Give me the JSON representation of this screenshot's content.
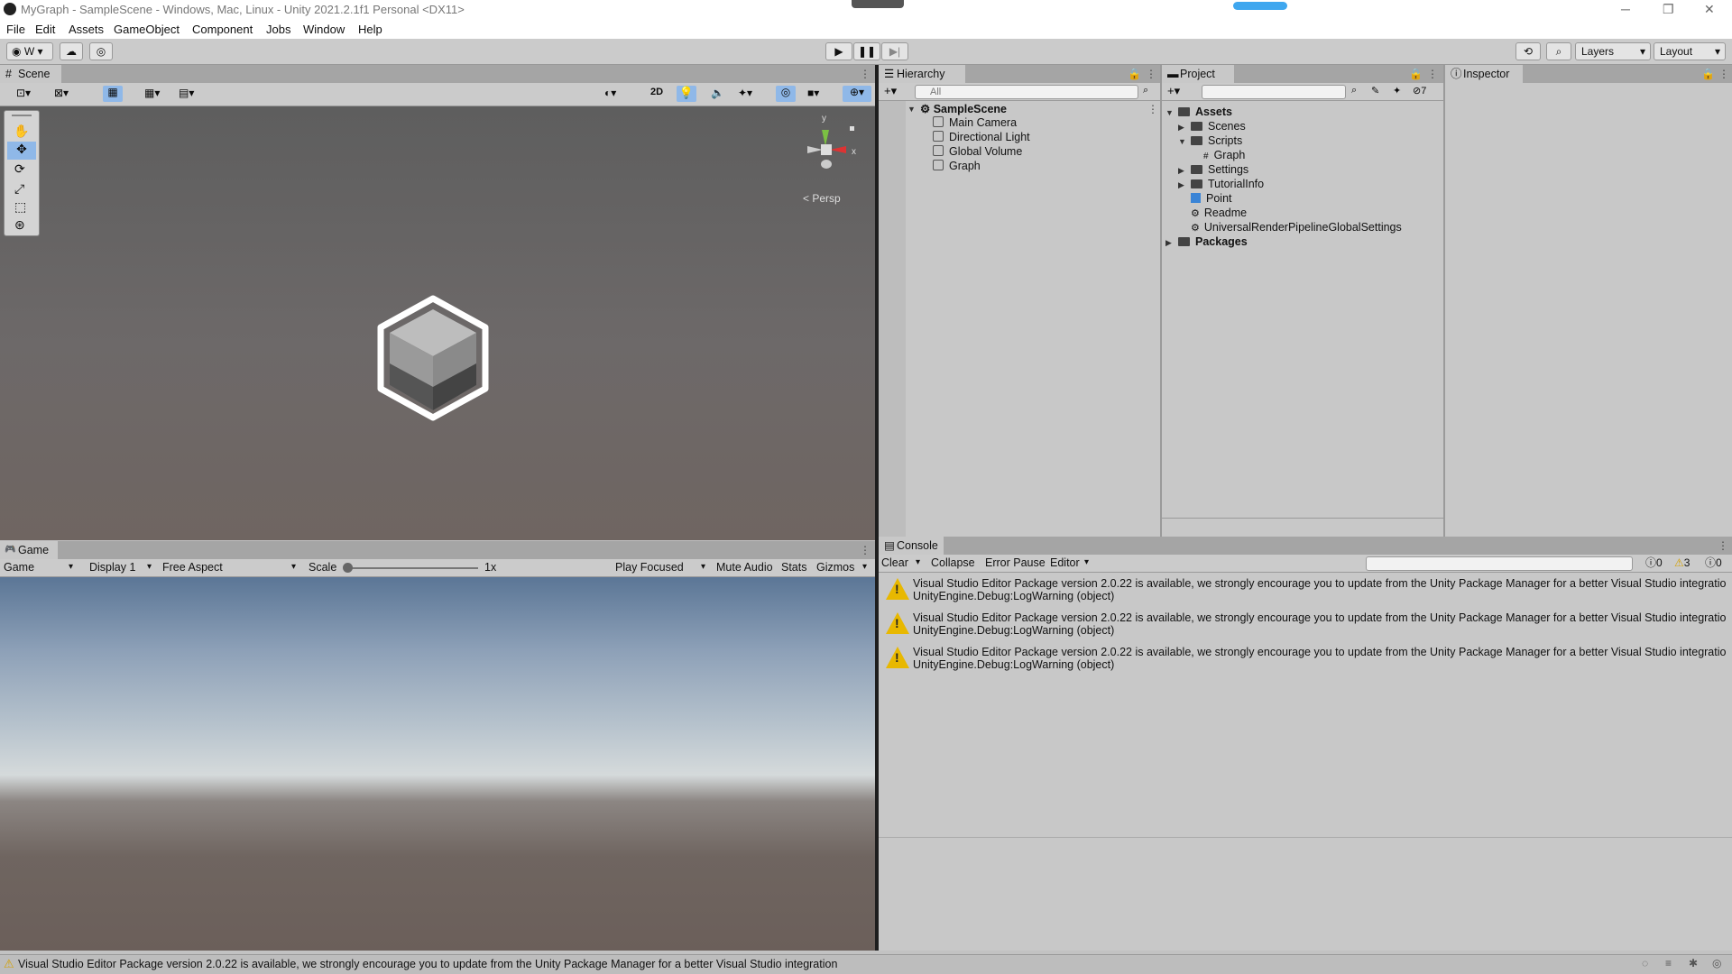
{
  "window": {
    "title": "MyGraph - SampleScene - Windows, Mac, Linux - Unity 2021.2.1f1 Personal <DX11>"
  },
  "menu": [
    "File",
    "Edit",
    "Assets",
    "GameObject",
    "Component",
    "Jobs",
    "Window",
    "Help"
  ],
  "toolbar": {
    "account": "W",
    "layers": "Layers",
    "layout": "Layout"
  },
  "scene": {
    "tab": "Scene",
    "toggle_2d": "2D",
    "persp": "< Persp",
    "gizmo_y": "y",
    "gizmo_x": "x"
  },
  "game": {
    "tab": "Game",
    "mode": "Game",
    "display": "Display 1",
    "aspect": "Free Aspect",
    "scale_label": "Scale",
    "scale_value": "1x",
    "play_focused": "Play Focused",
    "mute_audio": "Mute Audio",
    "stats": "Stats",
    "gizmos": "Gizmos"
  },
  "hierarchy": {
    "tab": "Hierarchy",
    "search_placeholder": "All",
    "scene_name": "SampleScene",
    "items": [
      "Main Camera",
      "Directional Light",
      "Global Volume",
      "Graph"
    ]
  },
  "project": {
    "tab": "Project",
    "hidden_count": "7",
    "assets_root": "Assets",
    "tree": [
      "Scenes",
      "Scripts",
      "Graph",
      "Settings",
      "TutorialInfo",
      "Point",
      "Readme",
      "UniversalRenderPipelineGlobalSettings"
    ],
    "packages": "Packages"
  },
  "inspector": {
    "tab": "Inspector"
  },
  "console": {
    "tab": "Console",
    "clear": "Clear",
    "collapse": "Collapse",
    "error_pause": "Error Pause",
    "editor": "Editor",
    "count_info": "0",
    "count_warn": "3",
    "count_error": "0",
    "messages": [
      {
        "line1": "Visual Studio Editor Package version 2.0.22 is available, we strongly encourage you to update from the Unity Package Manager for a better Visual Studio integratio",
        "line2": "UnityEngine.Debug:LogWarning (object)"
      },
      {
        "line1": "Visual Studio Editor Package version 2.0.22 is available, we strongly encourage you to update from the Unity Package Manager for a better Visual Studio integratio",
        "line2": "UnityEngine.Debug:LogWarning (object)"
      },
      {
        "line1": "Visual Studio Editor Package version 2.0.22 is available, we strongly encourage you to update from the Unity Package Manager for a better Visual Studio integratio",
        "line2": "UnityEngine.Debug:LogWarning (object)"
      }
    ]
  },
  "status": {
    "message": "Visual Studio Editor Package version 2.0.22 is available, we strongly encourage you to update from the Unity Package Manager for a better Visual Studio integration"
  },
  "colors": {
    "accent": "#4a8cd8",
    "warning": "#e8b800"
  }
}
